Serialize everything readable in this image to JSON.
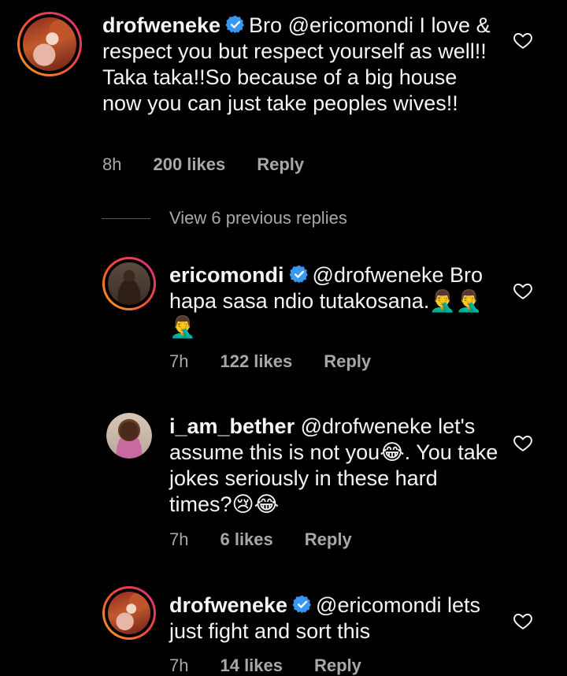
{
  "comments": [
    {
      "username": "drofweneke",
      "text": "Bro @ericomondi I love & respect you but respect yourself as well!! Taka taka!!So because of a big house now you can just take peoples wives!!",
      "time": "8h",
      "likes": "200 likes",
      "reply": "Reply"
    },
    {
      "username": "ericomondi",
      "text": "@drofweneke Bro hapa sasa ndio tutakosana.🤦‍♂️🤦‍♂️🤦‍♂️",
      "time": "7h",
      "likes": "122 likes",
      "reply": "Reply"
    },
    {
      "username": "i_am_bether",
      "text": "@drofweneke let's assume this is not you😂. You take jokes seriously in these hard times?😢😂",
      "time": "7h",
      "likes": "6 likes",
      "reply": "Reply"
    },
    {
      "username": "drofweneke",
      "text": "@ericomondi lets just fight and sort this",
      "time": "7h",
      "likes": "14 likes",
      "reply": "Reply"
    }
  ],
  "view_previous": "View 6 previous replies",
  "colors": {
    "background": "#000000",
    "text": "#f5f5f5",
    "meta": "#a8a8a8",
    "verified": "#3897f0"
  },
  "icons": {
    "verified": "verified-badge-icon",
    "like": "heart-outline-icon"
  }
}
